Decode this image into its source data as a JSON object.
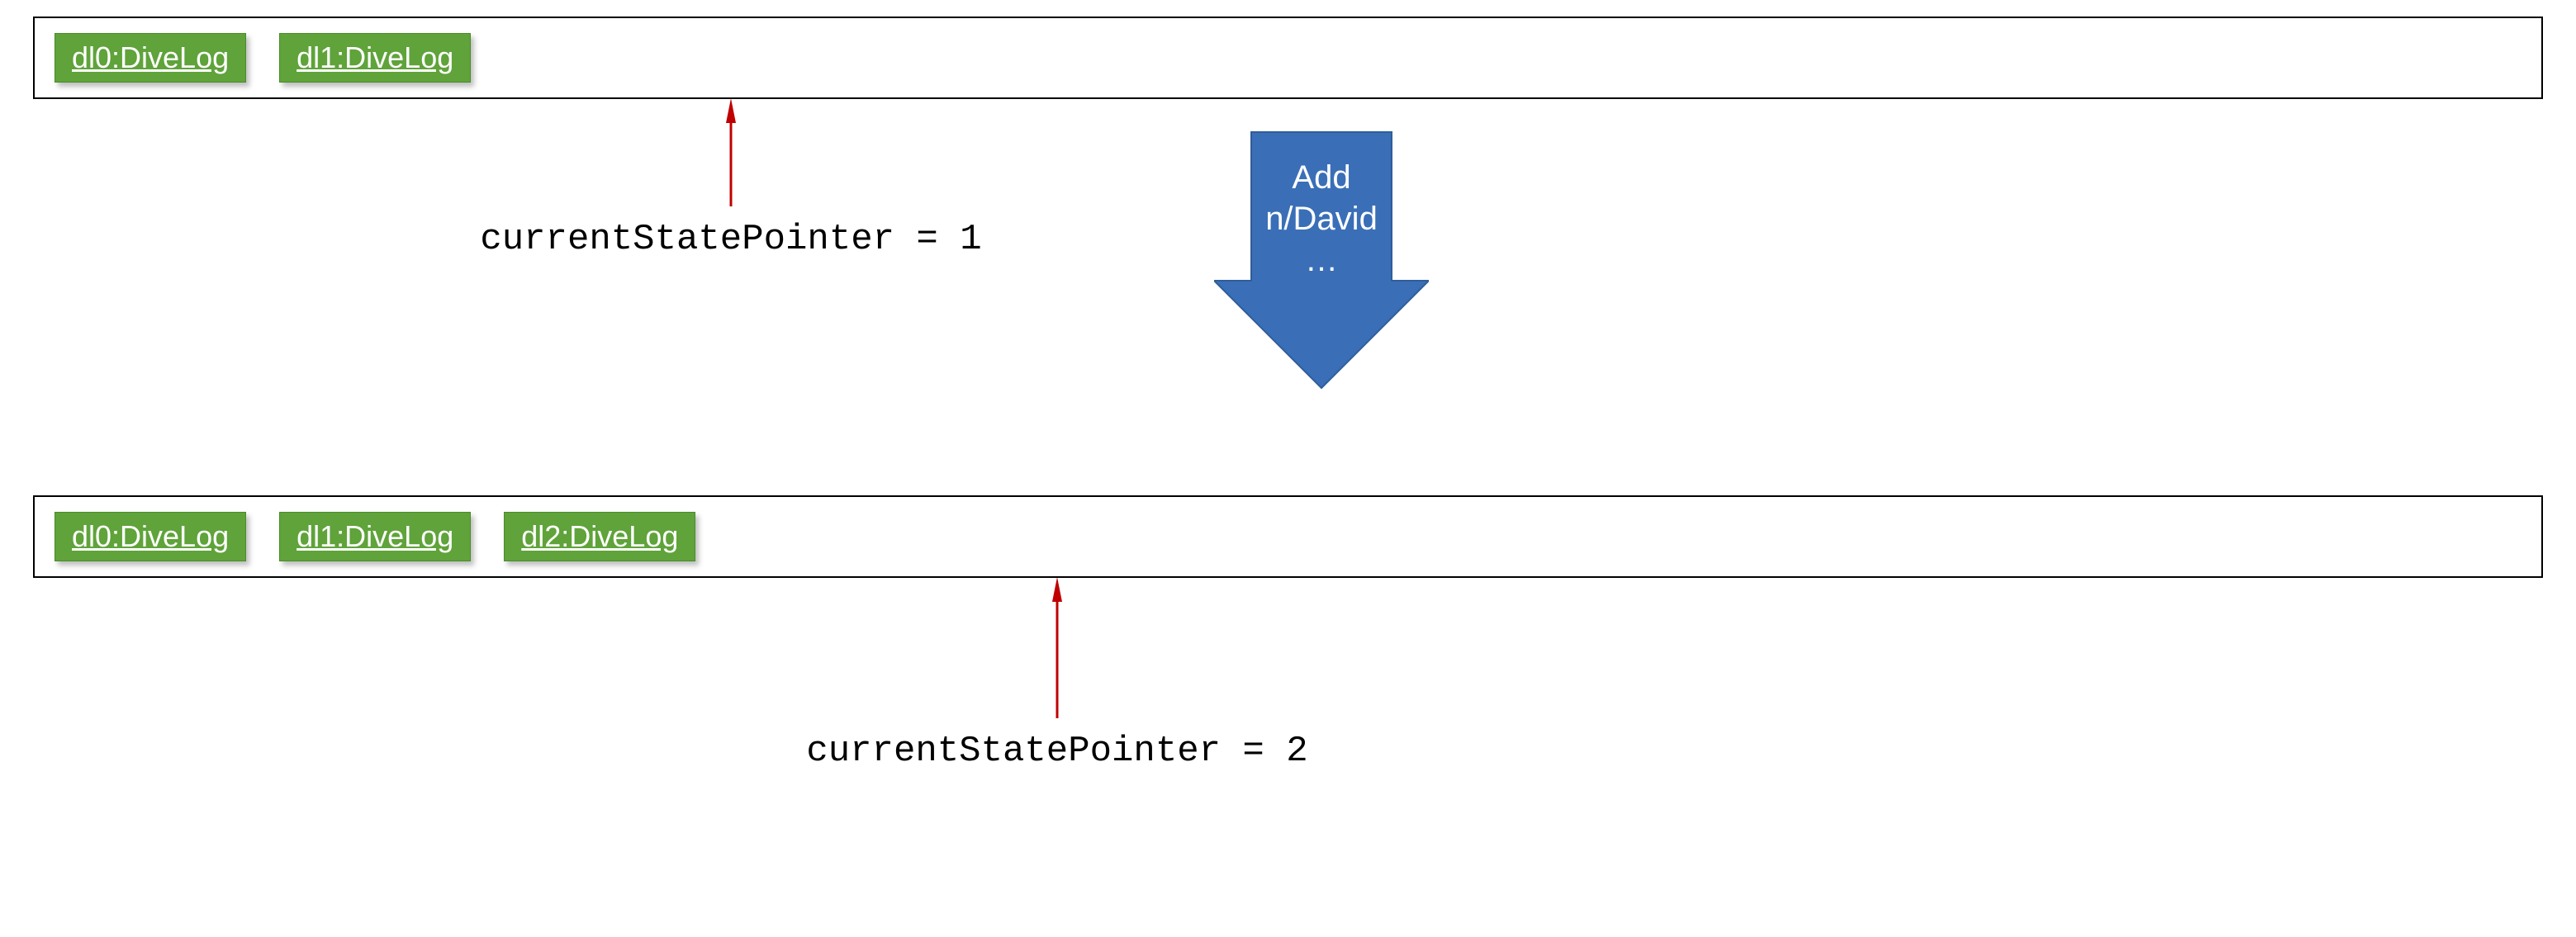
{
  "state1": {
    "nodes": [
      "dl0:DiveLog",
      "dl1:DiveLog"
    ],
    "pointer_label": "currentStatePointer = 1"
  },
  "action_arrow": {
    "line1": "Add",
    "line2": "n/David",
    "line3": "…"
  },
  "state2": {
    "nodes": [
      "dl0:DiveLog",
      "dl1:DiveLog",
      "dl2:DiveLog"
    ],
    "pointer_label": "currentStatePointer = 2"
  },
  "colors": {
    "node_bg": "#5FA33A",
    "arrow_fill": "#3A6FB7",
    "pointer_arrow": "#C00000"
  }
}
